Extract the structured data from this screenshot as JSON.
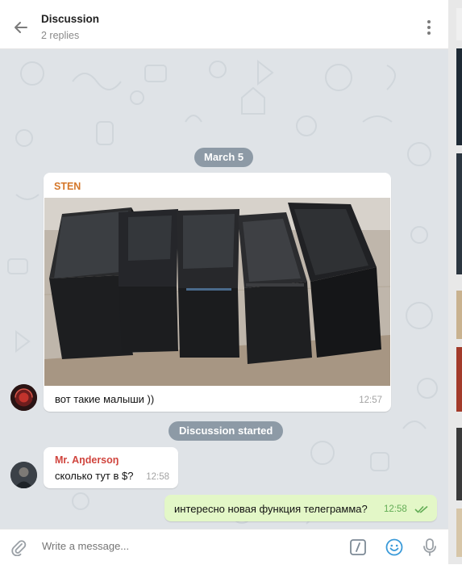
{
  "header": {
    "title": "Discussion",
    "subtitle": "2 replies"
  },
  "chat": {
    "date_label": "March 5",
    "discussion_label": "Discussion started",
    "messages": [
      {
        "author": "STEN",
        "text": "вот такие малыши ))",
        "time": "12:57",
        "has_photo": true,
        "author_color": "#d4772a"
      },
      {
        "author": "Mr. Aŋdersoŋ",
        "text": "сколько тут в $?",
        "time": "12:58",
        "author_color": "#d0453e"
      },
      {
        "outgoing": true,
        "text": "интересно новая функция телеграмма?",
        "time": "12:58",
        "status": "read",
        "status_icon": "double-check-icon"
      }
    ]
  },
  "composer": {
    "placeholder": "Write a message..."
  },
  "icons": {
    "back": "back-arrow-icon",
    "menu": "more-vertical-icon",
    "attach": "paperclip-icon",
    "commands": "slash-command-icon",
    "emoji": "emoji-icon",
    "voice": "microphone-icon"
  },
  "colors": {
    "chat_background": "#dfe3e7",
    "service_pill": "#8d9aa6",
    "outgoing_bubble": "#e3f7c7",
    "accent_blue": "#3a9ad9",
    "read_check": "#62ac55"
  }
}
